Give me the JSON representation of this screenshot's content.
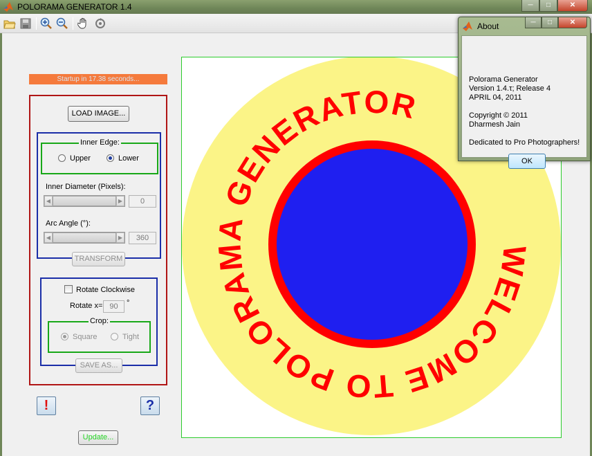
{
  "window": {
    "title": "POLORAMA GENERATOR 1.4",
    "controls": {
      "minimize": "─",
      "maximize": "□",
      "close": "✕"
    }
  },
  "toolbar": {
    "items": [
      "open-icon",
      "save-icon",
      "zoom-in-icon",
      "zoom-out-icon",
      "pan-hand-icon",
      "reset-view-icon"
    ]
  },
  "status": {
    "text": "Startup in 17.38 seconds..."
  },
  "controls": {
    "load_image": "LOAD IMAGE...",
    "inner_edge": {
      "label": "Inner Edge:",
      "upper": "Upper",
      "lower": "Lower",
      "selected": "Lower"
    },
    "inner_diameter": {
      "label": "Inner Diameter (Pixels):",
      "value": "0"
    },
    "arc_angle": {
      "label": "Arc Angle (°):",
      "value": "360"
    },
    "transform": "TRANSFORM",
    "rotate_clockwise": {
      "label": "Rotate Clockwise",
      "checked": false
    },
    "rotate_x": {
      "label": "Rotate x=",
      "value": "90",
      "unit": "°"
    },
    "crop": {
      "label": "Crop:",
      "square": "Square",
      "tight": "Tight",
      "selected": "Square"
    },
    "save_as": "SAVE AS...",
    "warning_button": "!",
    "help_button": "?",
    "update": "Update..."
  },
  "canvas": {
    "text": "WELCOME TO POLORAMA GENERATOR",
    "colors": {
      "outer_disc": "#fbf487",
      "ring": "#ff0000",
      "inner_disc": "#1f1ff0",
      "text": "#ff0000",
      "border": "#2bcc2b"
    }
  },
  "about": {
    "title": "About",
    "lines": [
      "Polorama Generator",
      "Version 1.4.τ;  Release 4",
      "APRIL 04, 2011",
      "Copyright © 2011",
      "Dharmesh Jain",
      "Dedicated to Pro Photographers!"
    ],
    "ok": "OK"
  }
}
